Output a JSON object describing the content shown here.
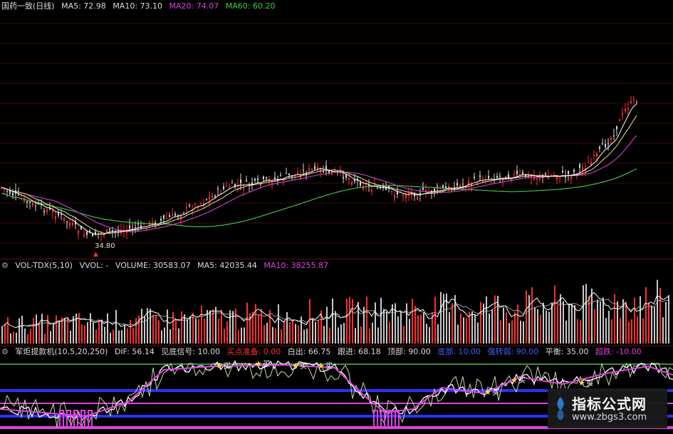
{
  "price_header": {
    "title": "国药一致(日线)",
    "ma5": "MA5: 72.98",
    "ma10": "MA10: 73.10",
    "ma20": "MA20: 74.07",
    "ma60": "MA60: 60.20",
    "low_label": "34.80"
  },
  "vol_header": {
    "title": "VOL-TDX(5,10)",
    "vvol": "VVOL: -",
    "volume": "VOLUME: 30583.07",
    "ma5": "MA5: 42035.44",
    "ma10": "MA10: 38255.87"
  },
  "ind_header": {
    "title": "军炬提款机(10,5,20,250)",
    "dif": "DIF: 56.14",
    "signal": "见底信号: 10.00",
    "buy_prep": "买点准备: 0.00",
    "exit": "白出: 66.75",
    "follow": "跟进: 68.18",
    "top": "顶部: 90.00",
    "bottom": "底部: 10.00",
    "strong": "强转弱: 90.00",
    "balance": "平衡: 35.00",
    "oversold": "超跌: -10.00"
  },
  "buy_marker": "买",
  "watermark": {
    "title": "指标公式网",
    "url": "www.zbgs3.com"
  },
  "colors": {
    "up": "#ff3030",
    "down": "#e0e0e0",
    "ma5": "#ffffff",
    "ma10": "#f0e060",
    "ma20": "#e040e0",
    "ma60": "#40c040",
    "vol_ma": "#ffffff"
  }
}
